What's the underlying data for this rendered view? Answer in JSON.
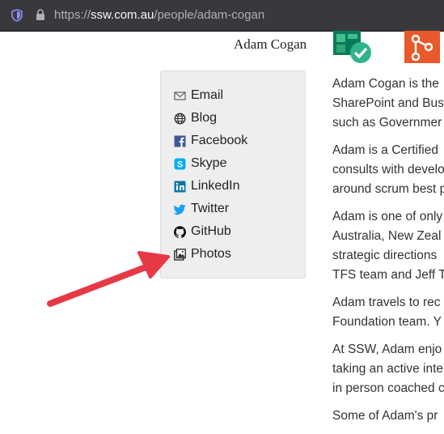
{
  "browser": {
    "url_prefix": "https://",
    "url_host": "ssw.com.au",
    "url_path": "/people/adam-cogan"
  },
  "profile": {
    "name": "Adam Cogan"
  },
  "social": {
    "items": [
      {
        "label": "Email",
        "icon": "envelope-icon"
      },
      {
        "label": "Blog",
        "icon": "globe-icon"
      },
      {
        "label": "Facebook",
        "icon": "facebook-icon"
      },
      {
        "label": "Skype",
        "icon": "skype-icon"
      },
      {
        "label": "LinkedIn",
        "icon": "linkedin-icon"
      },
      {
        "label": "Twitter",
        "icon": "twitter-icon"
      },
      {
        "label": "GitHub",
        "icon": "github-icon"
      },
      {
        "label": "Photos",
        "icon": "photos-icon"
      }
    ]
  },
  "bio": {
    "p1": [
      "Adam Cogan is the",
      "SharePoint and Bus",
      "such as Governmer"
    ],
    "p2": [
      "Adam is a Certified",
      "consults with develo",
      "around scrum best p"
    ],
    "p3": [
      "Adam is one of only",
      "Australia, New Zeal",
      "strategic directions",
      "TFS team and Jeff T"
    ],
    "p4": [
      "Adam travels to rec",
      "Foundation team. Y"
    ],
    "p5": [
      "At SSW, Adam enjo",
      "taking an active inte",
      "in person coached c"
    ],
    "p6": [
      "Some of Adam's pr"
    ]
  },
  "colors": {
    "arrow": "#e63946",
    "chrome": "#38383d",
    "box": "#eeeeee"
  }
}
